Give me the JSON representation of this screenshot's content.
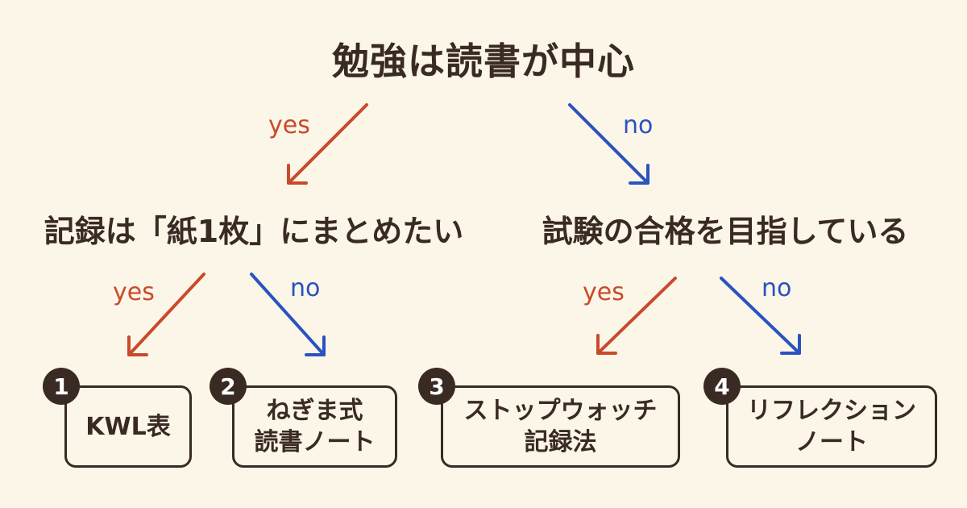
{
  "title": "勉強は読書が中心",
  "branch_labels": {
    "yes": "yes",
    "no": "no"
  },
  "questions": {
    "left": "記録は「紙1枚」にまとめたい",
    "right": "試験の合格を目指している"
  },
  "results": [
    {
      "number": "1",
      "lines": [
        "KWL表"
      ]
    },
    {
      "number": "2",
      "lines": [
        "ねぎま式",
        "読書ノート"
      ]
    },
    {
      "number": "3",
      "lines": [
        "ストップウォッチ",
        "記録法"
      ]
    },
    {
      "number": "4",
      "lines": [
        "リフレクション",
        "ノート"
      ]
    }
  ],
  "colors": {
    "background": "#fbf6e8",
    "text": "#3a2a24",
    "yes": "#c94a2b",
    "no": "#2a52c0"
  }
}
